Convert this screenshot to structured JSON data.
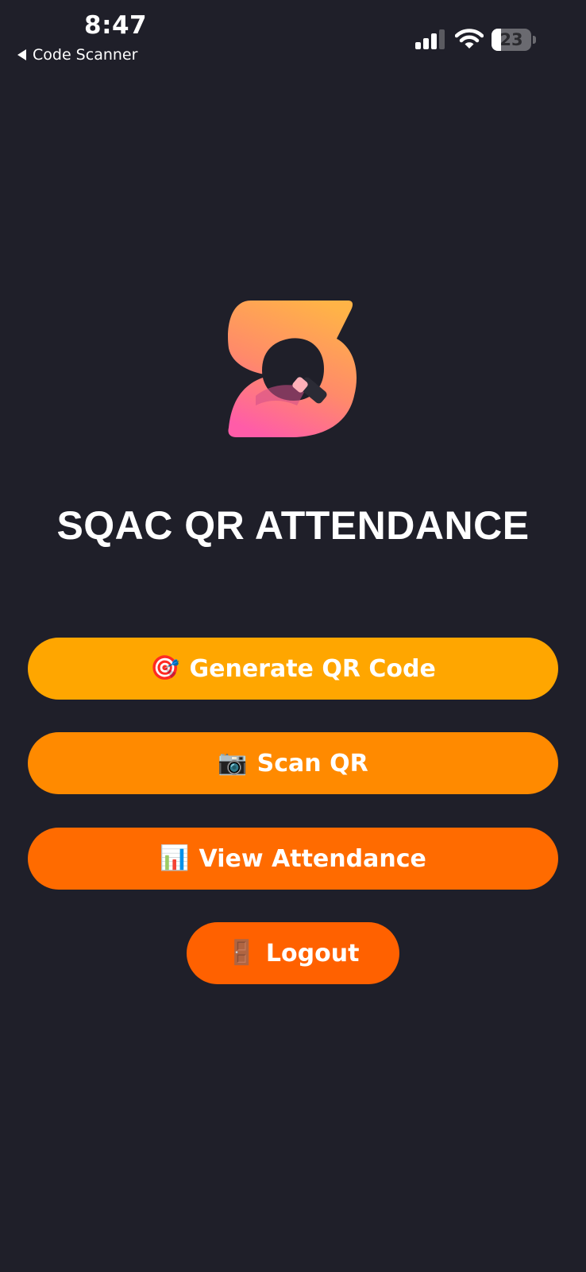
{
  "status_bar": {
    "time": "8:47",
    "back_label": "Code Scanner",
    "battery_percent": "23",
    "battery_level": 0.23
  },
  "app": {
    "title": "SQAC QR ATTENDANCE"
  },
  "buttons": {
    "generate": {
      "icon": "🎯",
      "icon_name": "target-icon",
      "label": "Generate QR Code",
      "color": "#ffa600"
    },
    "scan": {
      "icon": "📷",
      "icon_name": "camera-icon",
      "label": "Scan QR",
      "color": "#ff8a00"
    },
    "view": {
      "icon": "📊",
      "icon_name": "bar-chart-icon",
      "label": "View Attendance",
      "color": "#ff6b00"
    },
    "logout": {
      "icon": "🚪",
      "icon_name": "door-icon",
      "label": "Logout",
      "color": "#ff6100"
    }
  },
  "colors": {
    "background": "#1f1f29",
    "logo_gradient_top": "#ffb347",
    "logo_gradient_bottom": "#ff5ca8"
  }
}
